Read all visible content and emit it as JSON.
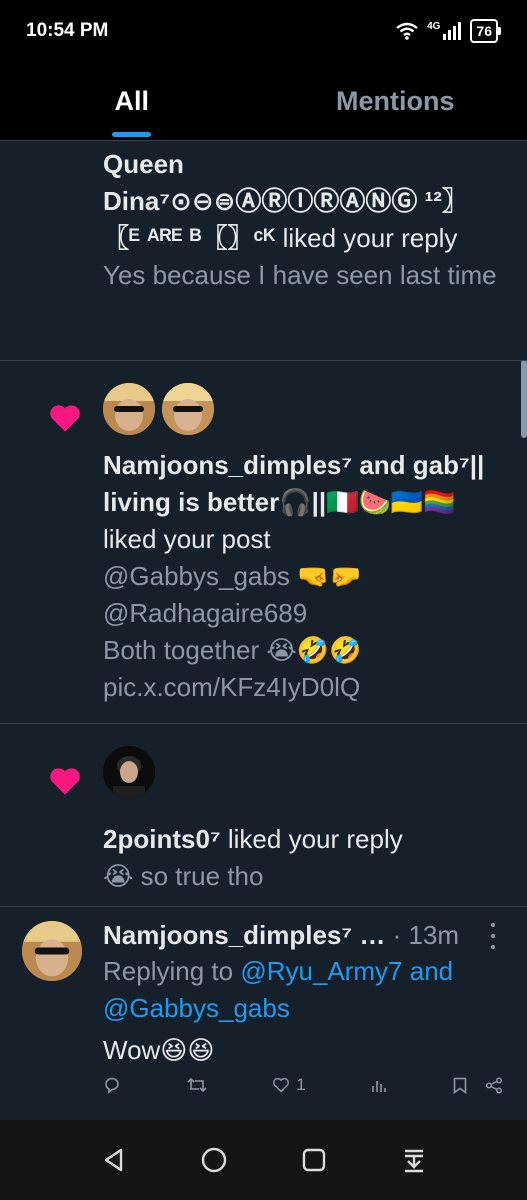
{
  "status": {
    "time": "10:54 PM",
    "network": "4G",
    "battery": "76"
  },
  "tabs": [
    {
      "label": "All"
    },
    {
      "label": "Mentions"
    }
  ],
  "notifications": [
    {
      "line1": "Queen",
      "line2": "Dina⁷⊙⊖⊜ⒶⓇⒾⓇⒶⓃⒼ ¹²〗",
      "line3_name": "〖ᴱ ᴬᴿᴱ ᴮ〖〗ᶜᴷ",
      "action": "liked your reply",
      "snippet": "Yes because I have seen last time"
    },
    {
      "name_line1": "Namjoons_dimples⁷ and gab⁷||",
      "name_line2": "living is better🎧||🇮🇹🍉🇺🇦🏳️‍🌈",
      "action": "liked your post",
      "snippet_lines": [
        "@Gabbys_gabs  🤜🤛",
        "@Radhagaire689",
        "Both together 😭🤣🤣",
        "pic.x.com/KFz4IyD0lQ"
      ]
    },
    {
      "name": "2points0⁷",
      "action": "liked your reply",
      "snippet": "😭 so true tho"
    }
  ],
  "tweet": {
    "author": "Namjoons_dimples⁷ …",
    "time": "· 13m",
    "replying_prefix": "Replying to",
    "replying_handles_1": "@Ryu_Army7 and",
    "replying_handles_2": "@Gabbys_gabs",
    "body": "Wow😆😆",
    "likes": "1"
  }
}
